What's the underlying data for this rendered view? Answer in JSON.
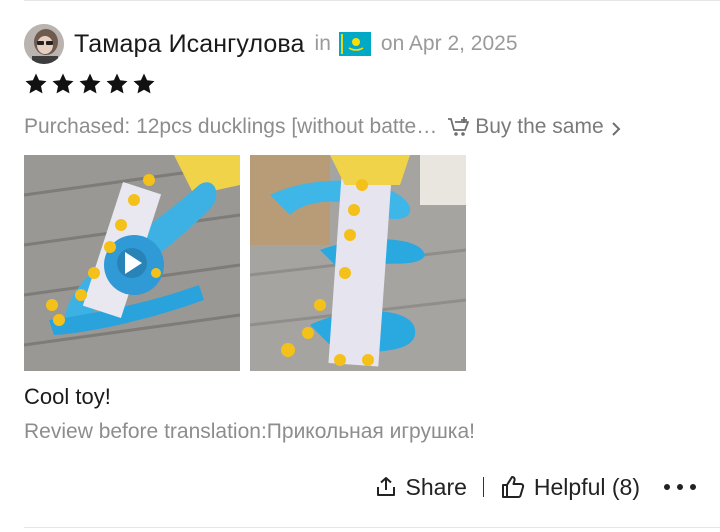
{
  "review": {
    "reviewer_name": "Тамара Исангулова",
    "in_label": "in",
    "country_flag_icon": "kazakhstan-flag-icon",
    "date_label": "on Apr 2, 2025",
    "rating": 5,
    "rating_max": 5,
    "purchase_text": "Purchased: 12pcs ducklings [without batte…",
    "buy_same_label": "Buy the same",
    "photos": [
      {
        "icon": "photo-video-thumbnail",
        "has_play": true
      },
      {
        "icon": "photo-thumbnail",
        "has_play": false
      }
    ],
    "review_text": "Cool toy!",
    "original_text": "Review before translation:Прикольная игрушка!"
  },
  "actions": {
    "share_label": "Share",
    "helpful_label": "Helpful (8)",
    "more_icon": "more-dots-icon"
  },
  "colors": {
    "star": "#111111",
    "muted_text": "#8d8d8d",
    "flag_bg": "#00a9c6",
    "flag_sun": "#fedd00"
  }
}
